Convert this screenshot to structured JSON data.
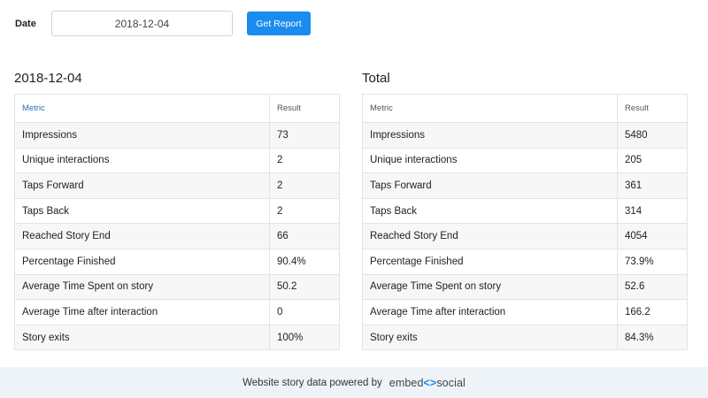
{
  "filter": {
    "date_label": "Date",
    "date_value": "2018-12-04",
    "button_label": "Get Report"
  },
  "daily": {
    "title": "2018-12-04",
    "header_metric": "Metric",
    "header_result": "Result",
    "rows": [
      {
        "metric": "Impressions",
        "result": "73"
      },
      {
        "metric": "Unique interactions",
        "result": "2"
      },
      {
        "metric": "Taps Forward",
        "result": "2"
      },
      {
        "metric": "Taps Back",
        "result": "2"
      },
      {
        "metric": "Reached Story End",
        "result": "66"
      },
      {
        "metric": "Percentage Finished",
        "result": "90.4%"
      },
      {
        "metric": "Average Time Spent on story",
        "result": "50.2"
      },
      {
        "metric": "Average Time after interaction",
        "result": "0"
      },
      {
        "metric": "Story exits",
        "result": "100%"
      }
    ]
  },
  "total": {
    "title": "Total",
    "header_metric": "Metric",
    "header_result": "Result",
    "rows": [
      {
        "metric": "Impressions",
        "result": "5480"
      },
      {
        "metric": "Unique interactions",
        "result": "205"
      },
      {
        "metric": "Taps Forward",
        "result": "361"
      },
      {
        "metric": "Taps Back",
        "result": "314"
      },
      {
        "metric": "Reached Story End",
        "result": "4054"
      },
      {
        "metric": "Percentage Finished",
        "result": "73.9%"
      },
      {
        "metric": "Average Time Spent on story",
        "result": "52.6"
      },
      {
        "metric": "Average Time after interaction",
        "result": "166.2"
      },
      {
        "metric": "Story exits",
        "result": "84.3%"
      }
    ]
  },
  "footer": {
    "text": "Website story data powered by",
    "logo_left": "embed",
    "logo_mark": "<>",
    "logo_right": "social"
  },
  "colors": {
    "accent": "#1a8cf0",
    "footer_bg": "#eef3f8"
  }
}
